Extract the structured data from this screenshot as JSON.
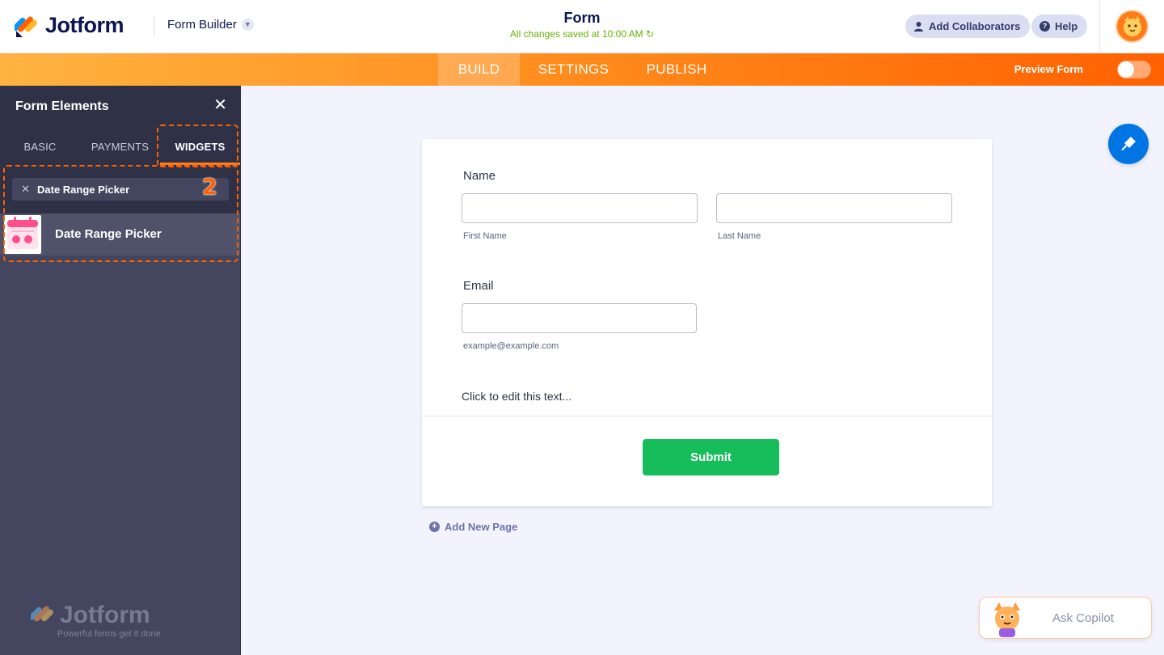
{
  "header": {
    "brand": "Jotform",
    "builder_label": "Form Builder",
    "form_title": "Form",
    "saved_status": "All changes saved at 10:00 AM",
    "add_collaborators": "Add Collaborators",
    "help": "Help"
  },
  "nav": {
    "tabs": [
      "BUILD",
      "SETTINGS",
      "PUBLISH"
    ],
    "active_tab": "BUILD",
    "preview_label": "Preview Form",
    "preview_on": false
  },
  "sidebar": {
    "title": "Form Elements",
    "tabs": [
      "BASIC",
      "PAYMENTS",
      "WIDGETS"
    ],
    "active_tab": "WIDGETS",
    "search_query": "Date Range Picker",
    "step_badge": "2",
    "results": [
      {
        "label": "Date Range Picker",
        "icon": "calendar-icon"
      }
    ],
    "footer_brand": "Jotform",
    "footer_tagline": "Powerful forms get it done"
  },
  "form": {
    "name_label": "Name",
    "first_name_sub": "First Name",
    "last_name_sub": "Last Name",
    "email_label": "Email",
    "email_sub": "example@example.com",
    "text_block": "Click to edit this text...",
    "submit_label": "Submit",
    "add_new_page": "Add New Page"
  },
  "copilot": {
    "label": "Ask Copilot"
  },
  "colors": {
    "brand_navy": "#0a1551",
    "nav_orange": "#ff6100",
    "sidebar_dark": "#2f3247",
    "sidebar_mid": "#43465e",
    "submit_green": "#18bd5b",
    "saved_green": "#64b200",
    "designer_blue": "#0075e3"
  }
}
